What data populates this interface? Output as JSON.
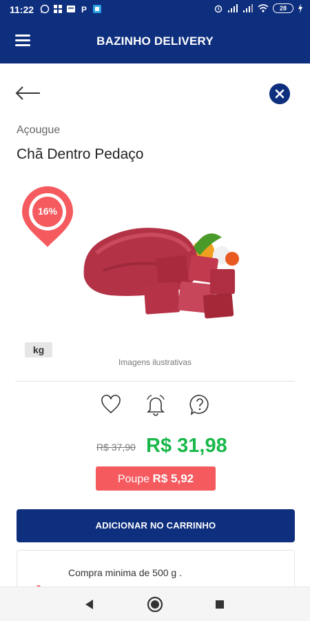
{
  "status_bar": {
    "time": "11:22",
    "battery": "28"
  },
  "app_bar": {
    "title": "BAZINHO DELIVERY"
  },
  "product": {
    "category": "Açougue",
    "name": "Chã Dentro Pedaço",
    "discount": "16%",
    "unit": "kg",
    "image_caption": "Imagens ilustrativas",
    "old_price": "R$ 37,90",
    "price": "R$ 31,98",
    "savings_label": "Poupe",
    "savings_value": "R$ 5,92"
  },
  "actions": {
    "add_to_cart": "ADICIONAR NO CARRINHO"
  },
  "info": {
    "min_purchase": "Compra minima de 500 g ."
  },
  "colors": {
    "primary": "#0e2f7e",
    "price_green": "#1ab84b",
    "discount_red": "#f55a5f"
  },
  "icons": [
    "menu-icon",
    "back-arrow-icon",
    "close-icon",
    "heart-icon",
    "bell-icon",
    "question-icon",
    "nav-back-icon",
    "nav-home-icon",
    "nav-recents-icon"
  ]
}
